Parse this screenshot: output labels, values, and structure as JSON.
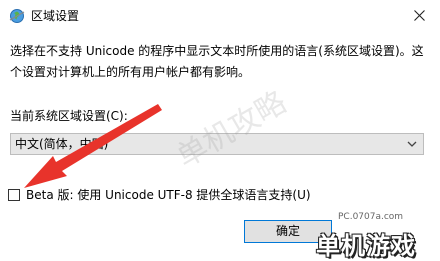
{
  "window": {
    "title": "区域设置",
    "icon": "globe-icon",
    "close_icon": "close-icon"
  },
  "description": {
    "line1": "选择在不支持 Unicode 的程序中显示文本时所使用的语言(系统区域设置)。这",
    "line2": "个设置对计算机上的所有用户帐户都有影响。"
  },
  "locale": {
    "label": "当前系统区域设置(C):",
    "selected": "中文(简体，中国)"
  },
  "beta": {
    "checked": false,
    "label": "Beta 版: 使用 Unicode UTF-8 提供全球语言支持(U)"
  },
  "buttons": {
    "ok": "确定"
  },
  "overlay": {
    "annotation_color": "#e8332b",
    "watermark": "单机攻略",
    "site_url": "PC.0707a.com",
    "logo_text": "单机游戏"
  }
}
